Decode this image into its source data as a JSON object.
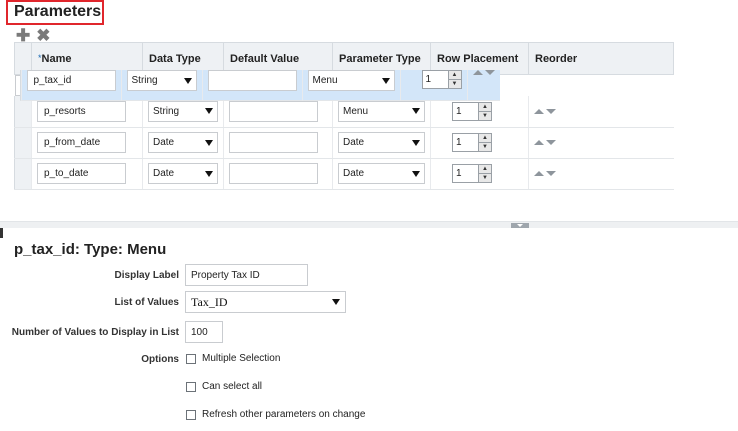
{
  "section": {
    "title": "Parameters"
  },
  "toolbar": {
    "add_icon": "plus-icon",
    "delete_icon": "x-icon",
    "add_glyph": "✚",
    "delete_glyph": "✖"
  },
  "table": {
    "required_mark": "*",
    "columns": [
      "Name",
      "Data Type",
      "Default Value",
      "Parameter Type",
      "Row Placement",
      "Reorder"
    ],
    "rows": [
      {
        "name": "p_tax_id",
        "data_type": "String",
        "default_value": "",
        "parameter_type": "Menu",
        "row_placement": "1",
        "selected": true
      },
      {
        "name": "p_resorts",
        "data_type": "String",
        "default_value": "",
        "parameter_type": "Menu",
        "row_placement": "1",
        "selected": false
      },
      {
        "name": "p_from_date",
        "data_type": "Date",
        "default_value": "",
        "parameter_type": "Date",
        "row_placement": "1",
        "selected": false
      },
      {
        "name": "p_to_date",
        "data_type": "Date",
        "default_value": "",
        "parameter_type": "Date",
        "row_placement": "1",
        "selected": false
      }
    ]
  },
  "detail": {
    "title": "p_tax_id: Type: Menu",
    "display_label": {
      "label": "Display Label",
      "value": "Property Tax ID"
    },
    "list_of_values": {
      "label": "List of Values",
      "value": "Tax_ID"
    },
    "num_values": {
      "label": "Number of Values to Display in List",
      "value": "100"
    },
    "options": {
      "label": "Options",
      "items": [
        {
          "label": "Multiple Selection",
          "checked": false
        },
        {
          "label": "Can select all",
          "checked": false
        },
        {
          "label": "Refresh other parameters on change",
          "checked": false
        }
      ]
    }
  },
  "colors": {
    "accent_border": "#e0262c",
    "selected_row": "#d3e6f9",
    "header_bg": "#eef1f4"
  }
}
